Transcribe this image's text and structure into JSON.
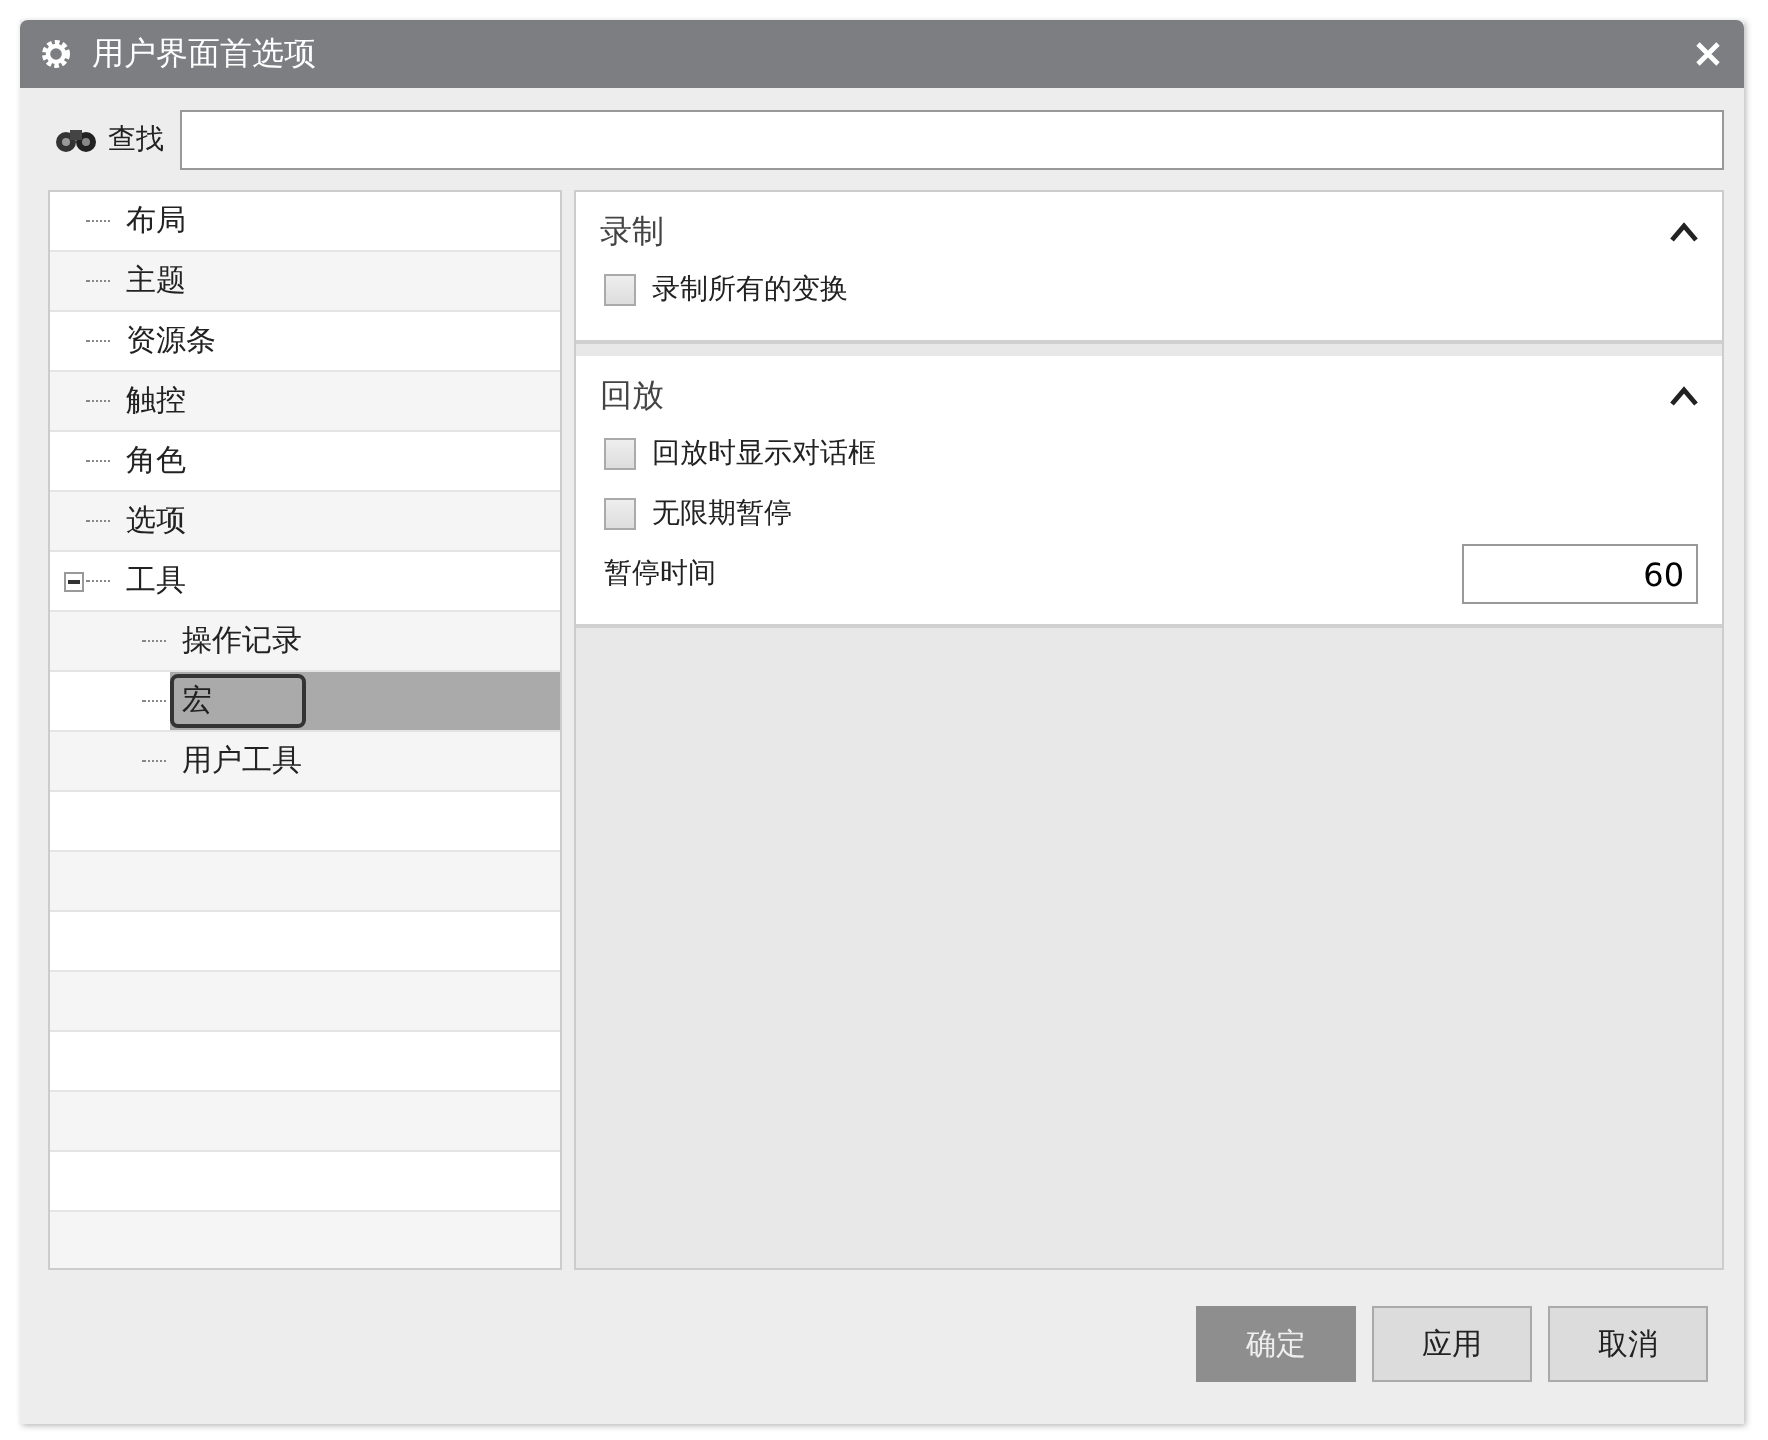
{
  "window": {
    "title": "用户界面首选项"
  },
  "search": {
    "label": "查找"
  },
  "tree": [
    {
      "label": "布局",
      "selected": false
    },
    {
      "label": "主题",
      "selected": false
    },
    {
      "label": "资源条",
      "selected": false
    },
    {
      "label": "触控",
      "selected": false
    },
    {
      "label": "角色",
      "selected": false
    },
    {
      "label": "选项",
      "selected": false
    },
    {
      "label": "工具",
      "selected": false,
      "expanded": true,
      "children": [
        {
          "label": "操作记录",
          "selected": false
        },
        {
          "label": "宏",
          "selected": true
        },
        {
          "label": "用户工具",
          "selected": false
        }
      ]
    }
  ],
  "sections": [
    {
      "title": "录制",
      "expanded": true,
      "items": [
        {
          "kind": "checkbox",
          "label": "录制所有的变换",
          "checked": false
        }
      ]
    },
    {
      "title": "回放",
      "expanded": true,
      "items": [
        {
          "kind": "checkbox",
          "label": "回放时显示对话框",
          "checked": false
        },
        {
          "kind": "checkbox",
          "label": "无限期暂停",
          "checked": false
        },
        {
          "kind": "number",
          "label": "暂停时间",
          "value": "60"
        }
      ]
    }
  ],
  "buttons": [
    {
      "label": "确定",
      "default": true
    },
    {
      "label": "应用",
      "default": false
    },
    {
      "label": "取消",
      "default": false
    }
  ]
}
